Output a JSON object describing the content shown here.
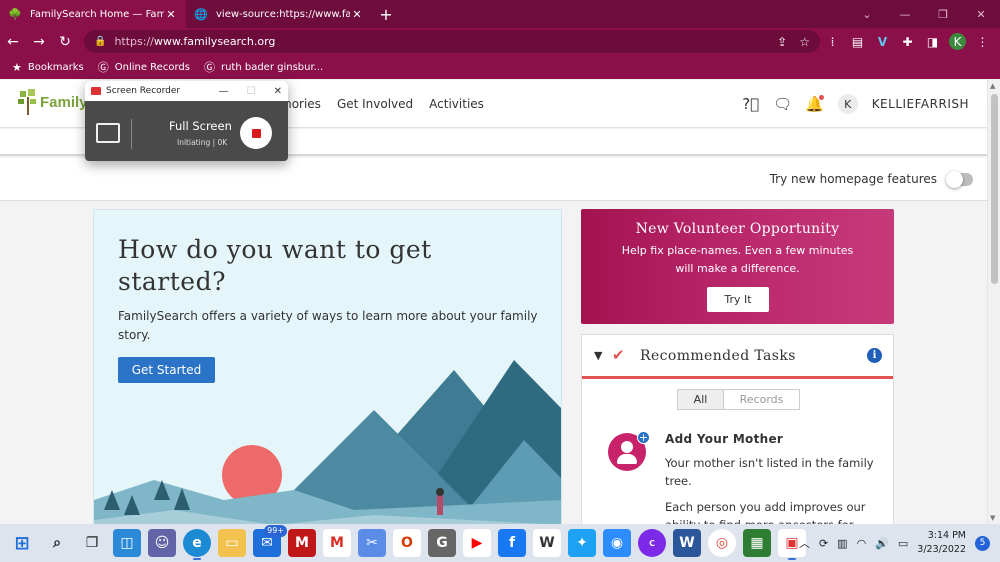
{
  "browser": {
    "tabs": [
      {
        "title": "FamilySearch Home — FamilySear",
        "active": true
      },
      {
        "title": "view-source:https://www.familysear",
        "active": false
      }
    ],
    "url_prefix": "https://",
    "url_host": "www.familysearch.org",
    "bookmarks": [
      "Bookmarks",
      "Online Records",
      "ruth bader ginsbur..."
    ],
    "profile_initial": "K"
  },
  "site": {
    "logo_text": "FamilyS",
    "nav": [
      "mories",
      "Get Involved",
      "Activities"
    ],
    "user_initial": "K",
    "user_name": "KELLIEFARRISH",
    "try_features_label": "Try new homepage features"
  },
  "hero": {
    "title": "How do you want to get started?",
    "body": "FamilySearch offers a variety of ways to learn more about your family story.",
    "button": "Get Started"
  },
  "promo": {
    "title": "New Volunteer Opportunity",
    "body": "Help fix place-names. Even a few minutes will make a difference.",
    "button": "Try It"
  },
  "tasks": {
    "title": "Recommended Tasks",
    "filters": [
      "All",
      "Records"
    ],
    "task_title": "Add Your Mother",
    "task_body_1": "Your mother isn't listed in the family tree.",
    "task_body_2": "Each person you add improves our ability to find more ancestors for"
  },
  "recorder": {
    "title": "Screen Recorder",
    "mode": "Full Screen",
    "status": "Initiating",
    "size": "0K"
  },
  "taskbar": {
    "mail_badge": "99+",
    "time": "3:14 PM",
    "date": "3/23/2022",
    "notifications": "5"
  },
  "colors": {
    "chrome_dark": "#6e0c3c",
    "chrome": "#8b1049",
    "accent_blue": "#2a73c7",
    "accent_red": "#e05452",
    "promo_magenta": "#b8266a"
  }
}
